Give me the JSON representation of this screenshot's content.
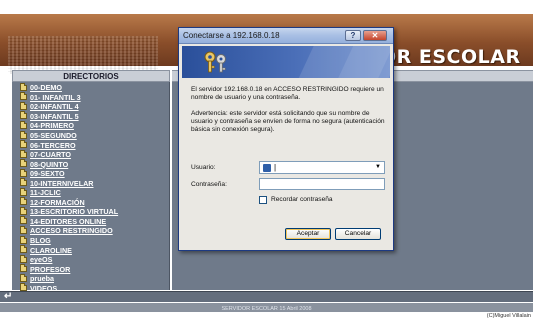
{
  "page": {
    "banner_title": "OR ESCOLAR",
    "directory_header": "DIRECTORIOS",
    "return_icon_glyph": "↵",
    "footer_text": "SERVIDOR ESCOLAR 15 Abril 2008",
    "credit": "(C)Miguel Villalain"
  },
  "sidebar": {
    "items": [
      {
        "label": "00-DEMO",
        "icon": "folder-icon"
      },
      {
        "label": "01- INFANTIL 3",
        "icon": "folder-icon"
      },
      {
        "label": "02-INFANTIL 4",
        "icon": "folder-icon"
      },
      {
        "label": "03-INFANTIL 5",
        "icon": "folder-icon"
      },
      {
        "label": "04-PRIMERO",
        "icon": "folder-icon"
      },
      {
        "label": "05-SEGUNDO",
        "icon": "folder-icon"
      },
      {
        "label": "06-TERCERO",
        "icon": "folder-icon"
      },
      {
        "label": "07-CUARTO",
        "icon": "folder-icon"
      },
      {
        "label": "08-QUINTO",
        "icon": "folder-icon"
      },
      {
        "label": "09-SEXTO",
        "icon": "folder-icon"
      },
      {
        "label": "10-INTERNIVELAR",
        "icon": "folder-icon"
      },
      {
        "label": "11-JCLIC",
        "icon": "folder-icon"
      },
      {
        "label": "12-FORMACIÓN",
        "icon": "folder-icon"
      },
      {
        "label": "13-ESCRITORIO VIRTUAL",
        "icon": "folder-icon"
      },
      {
        "label": "14-EDITORES ONLINE",
        "icon": "folder-icon"
      },
      {
        "label": "ACCESO RESTRINGIDO",
        "icon": "folder-icon"
      },
      {
        "label": "BLOG",
        "icon": "folder-icon"
      },
      {
        "label": "CLAROLINE",
        "icon": "folder-icon"
      },
      {
        "label": "eyeOS",
        "icon": "folder-icon"
      },
      {
        "label": "PROFESOR",
        "icon": "folder-icon"
      },
      {
        "label": "prueba",
        "icon": "folder-icon"
      },
      {
        "label": "VIDEOS",
        "icon": "folder-icon"
      }
    ]
  },
  "dialog": {
    "title": "Conectarse a 192.168.0.18",
    "help_glyph": "?",
    "close_glyph": "✕",
    "banner_icon": "keys-icon",
    "message": "El servidor 192.168.0.18 en ACCESO RESTRINGIDO requiere un nombre de usuario y una contraseña.",
    "warning": "Advertencia: este servidor está solicitando que su nombre de usuario y contraseña se envíen de forma no segura (autenticación básica sin conexión segura).",
    "user_label": "Usuario:",
    "user_value": "|",
    "dropdown_glyph": "▼",
    "password_label": "Contraseña:",
    "password_value": "",
    "remember_label": "Recordar contraseña",
    "remember_checked": false,
    "accept_label": "Aceptar",
    "cancel_label": "Cancelar",
    "colors": {
      "titlebar": "#a8bfe4",
      "banner": "#2a4f9a",
      "close": "#c4452c"
    }
  }
}
